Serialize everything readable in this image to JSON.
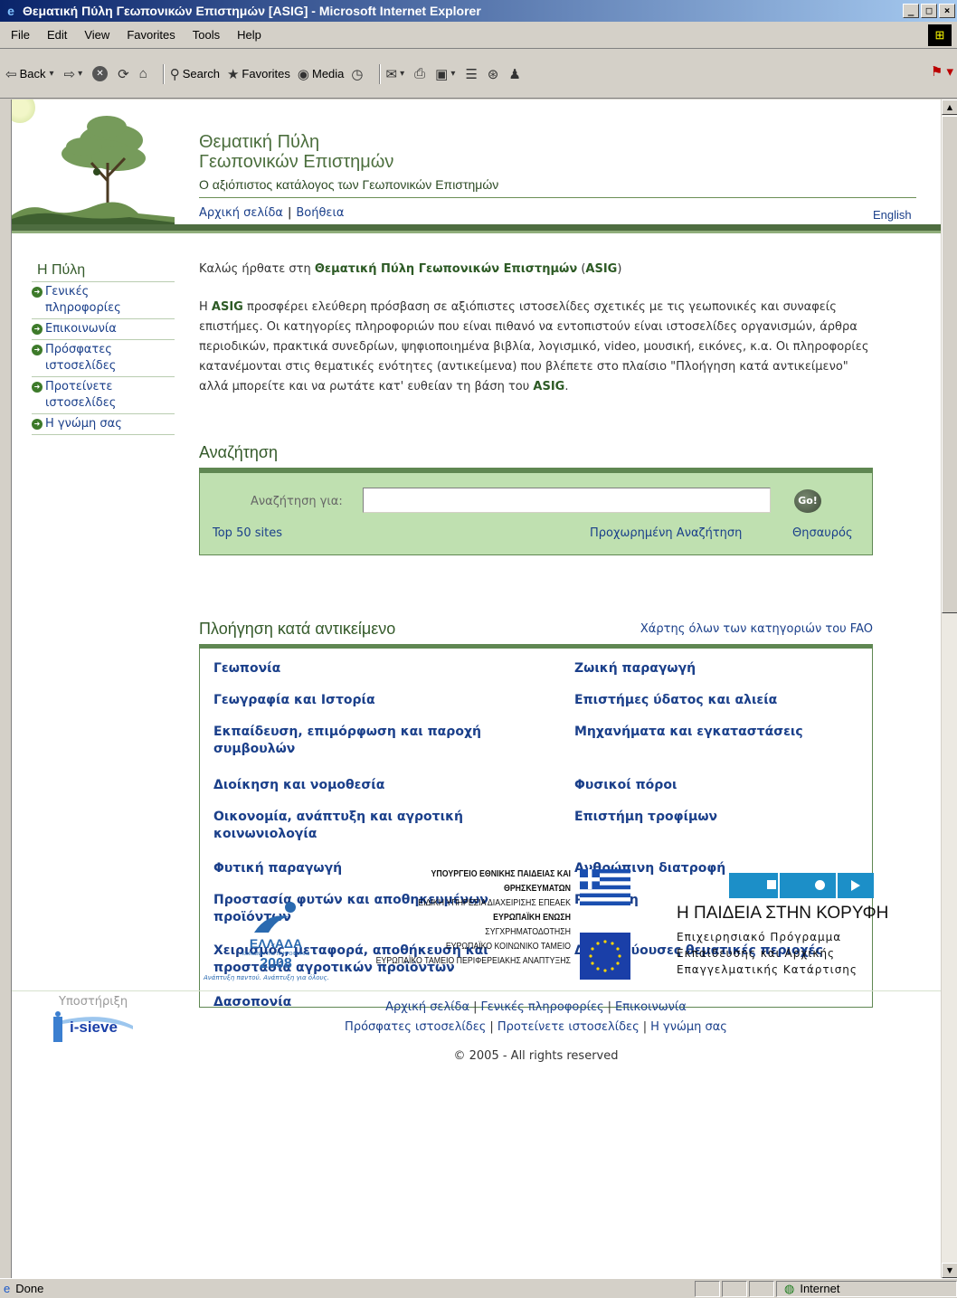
{
  "window": {
    "title": "Θεματική Πύλη Γεωπονικών Επιστημών [ASIG] - Microsoft Internet Explorer",
    "minimize": "_",
    "maximize": "□",
    "close": "×"
  },
  "menu": [
    "File",
    "Edit",
    "View",
    "Favorites",
    "Tools",
    "Help"
  ],
  "toolbar": {
    "back": "Back",
    "search": "Search",
    "favorites": "Favorites",
    "media": "Media"
  },
  "header": {
    "title_line1": "Θεματική Πύλη",
    "title_line2": "Γεωπονικών Επιστημών",
    "tagline": "Ο αξιόπιστος κατάλογος των Γεωπονικών Επιστημών",
    "home_link": "Αρχική σελίδα",
    "separator": "|",
    "help_link": "Βοήθεια",
    "english_link": "English"
  },
  "sidebar": {
    "title": "Η Πύλη",
    "items": [
      {
        "label": "Γενικές πληροφορίες"
      },
      {
        "label": "Επικοινωνία"
      },
      {
        "label": "Πρόσφατες ιστοσελίδες"
      },
      {
        "label": "Προτείνετε ιστοσελίδες"
      },
      {
        "label": "Η γνώμη σας"
      }
    ]
  },
  "welcome": {
    "prefix": "Καλώς ήρθατε στη ",
    "name": "Θεματική Πύλη Γεωπονικών Επιστημών",
    "open": " (",
    "acronym": "ASIG",
    "close": ")"
  },
  "intro": {
    "p1_prefix": "Η ",
    "acronym": "ASIG",
    "p1_text": " προσφέρει ελεύθερη πρόσβαση σε αξιόπιστες ιστοσελίδες σχετικές με τις γεωπονικές και συναφείς επιστήμες. Οι κατηγορίες πληροφοριών που είναι πιθανό να εντοπιστούν είναι ιστοσελίδες οργανισμών, άρθρα περιοδικών, πρακτικά συνεδρίων, ψηφιοποιημένα βιβλία, λογισμικό, video, μουσική, εικόνες, κ.α. Οι πληροφορίες κατανέμονται στις θεματικές ενότητες (αντικείμενα) που βλέπετε στο πλαίσιο \"Πλοήγηση κατά αντικείμενο\" αλλά μπορείτε και να ρωτάτε κατ' ευθείαν τη βάση του ",
    "p1_end": "."
  },
  "search": {
    "title": "Αναζήτηση",
    "label": "Αναζήτηση για:",
    "value": "",
    "go": "Go!",
    "top50": "Top 50 sites",
    "advanced": "Προχωρημένη Αναζήτηση",
    "thesaurus": "Θησαυρός"
  },
  "browse": {
    "title": "Πλοήγηση κατά αντικείμενο",
    "fao_link": "Χάρτης όλων των κατηγοριών του FAO",
    "left": [
      "Γεωπονία",
      "Γεωγραφία και Ιστορία",
      "Εκπαίδευση, επιμόρφωση και παροχή συμβουλών",
      "Διοίκηση και νομοθεσία",
      "Οικονομία, ανάπτυξη και αγροτική κοινωνιολογία",
      "Φυτική παραγωγή",
      "Προστασία φυτών και αποθηκευμένων προϊόντων",
      "Χειρισμός, μεταφορά, αποθήκευση και προστασία αγροτικών προϊόντων",
      "Δασοπονία"
    ],
    "right": [
      "Ζωική παραγωγή",
      "Επιστήμες ύδατος και αλιεία",
      "Μηχανήματα και εγκαταστάσεις",
      "Φυσικοί πόροι",
      "Επιστήμη τροφίμων",
      "Ανθρώπινη διατροφή",
      "Ρύπανση",
      "Δευτερεύουσες θεματικές περιοχές"
    ]
  },
  "sponsors": {
    "ellada_text": "ΕΛΛΑΔΑ",
    "ellada_sub": "ΚΟΙΝΩΝΙΑ ΤΗΣ ΠΛΗΡΟΦΟΡΙΑΣ",
    "ellada_year": "2008",
    "ellada_slogan": "Ανάπτυξη παντού. Ανάπτυξη για όλους.",
    "ministry_lines": [
      "ΥΠΟΥΡΓΕΙΟ ΕΘΝΙΚΗΣ ΠΑΙΔΕΙΑΣ ΚΑΙ ΘΡΗΣΚΕΥΜΑΤΩΝ",
      "ΕΙΔΙΚΗ ΥΠΗΡΕΣΙΑ ΔΙΑΧΕΙΡΙΣΗΣ ΕΠΕΑΕΚ",
      "ΕΥΡΩΠΑΪΚΗ ΕΝΩΣΗ",
      "ΣΥΓΧΡΗΜΑΤΟΔΟΤΗΣΗ",
      "ΕΥΡΩΠΑΪΚΟ ΚΟΙΝΩΝΙΚΟ ΤΑΜΕΙΟ",
      "ΕΥΡΩΠΑΪΚΟ ΤΑΜΕΙΟ ΠΕΡΙΦΕΡΕΙΑΚΗΣ ΑΝΑΠΤΥΞΗΣ"
    ],
    "paideia_title": "Η ΠΑΙΔΕΙΑ ΣΤΗΝ ΚΟΡΥΦΗ",
    "paideia_lines": [
      "Επιχειρησιακό Πρόγραμμα",
      "Εκπαίδευσης και Αρχικής",
      "Επαγγελματικής Κατάρτισης"
    ]
  },
  "footer": {
    "support": "Υποστήριξη",
    "isieve": "i-sieve",
    "row1": [
      "Αρχική σελίδα",
      "Γενικές πληροφορίες",
      "Επικοινωνία"
    ],
    "row2": [
      "Πρόσφατες ιστοσελίδες",
      "Προτείνετε ιστοσελίδες",
      "Η γνώμη σας"
    ],
    "separator": "|",
    "copyright": "© 2005 - All rights reserved"
  },
  "status": {
    "text": "Done",
    "zone": "Internet"
  },
  "colors": {
    "accent_green": "#4e6d40",
    "search_bg": "#bfe0b0",
    "link_blue": "#1a3f8a"
  }
}
